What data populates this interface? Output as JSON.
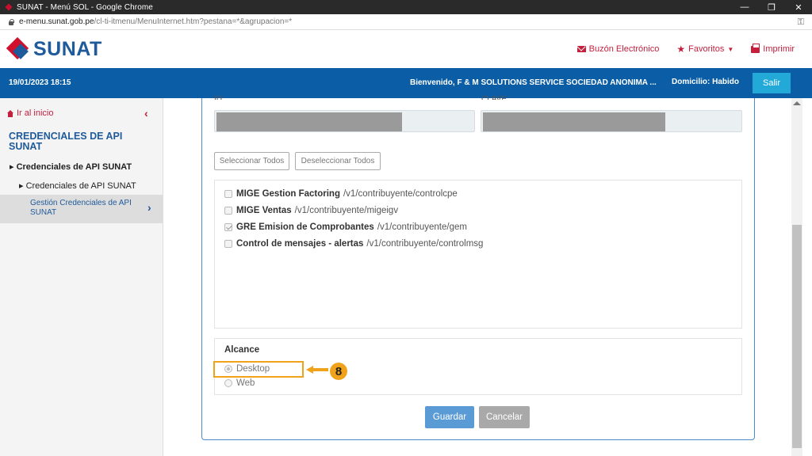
{
  "window": {
    "title": "SUNAT - Menú SOL - Google Chrome",
    "minimize": "—",
    "restore": "❐",
    "close": "✕"
  },
  "urlbar": {
    "host": "e-menu.sunat.gob.pe",
    "path": "/cl-ti-itmenu/MenuInternet.htm?pestana=*&agrupacion=*"
  },
  "header": {
    "logo_text": "SUNAT",
    "links": {
      "buzon": "Buzón Electrónico",
      "favoritos": "Favoritos",
      "imprimir": "Imprimir"
    }
  },
  "bluebar": {
    "datetime": "19/01/2023 18:15",
    "welcome": "Bienvenido, F & M SOLUTIONS SERVICE SOCIEDAD ANONIMA ...",
    "domicilio": "Domicilio: Habido",
    "salir": "Salir"
  },
  "sidebar": {
    "home": "Ir al inicio",
    "title": "CREDENCIALES DE API SUNAT",
    "item1": "Credenciales de API SUNAT",
    "item2": "Credenciales de API SUNAT",
    "active": "Gestión Credenciales de API SUNAT"
  },
  "form": {
    "id_label": "ID:",
    "clave_label": "CLAVE:",
    "select_all": "Seleccionar Todos",
    "deselect_all": "Deseleccionar Todos",
    "apis": [
      {
        "name": "MIGE Gestion Factoring",
        "path": "/v1/contribuyente/controlcpe",
        "checked": false
      },
      {
        "name": "MIGE Ventas",
        "path": "/v1/contribuyente/migeigv",
        "checked": false
      },
      {
        "name": "GRE Emision de Comprobantes",
        "path": "/v1/contribuyente/gem",
        "checked": true
      },
      {
        "name": "Control de mensajes - alertas",
        "path": "/v1/contribuyente/controlmsg",
        "checked": false
      }
    ],
    "alcance_label": "Alcance",
    "options": [
      {
        "label": "Desktop",
        "selected": true
      },
      {
        "label": "Web",
        "selected": false
      }
    ],
    "step_number": "8",
    "guardar": "Guardar",
    "cancelar": "Cancelar"
  },
  "colors": {
    "brand_blue": "#0b5ea6",
    "brand_red": "#c41f3c",
    "annotation": "#f0a31a"
  }
}
